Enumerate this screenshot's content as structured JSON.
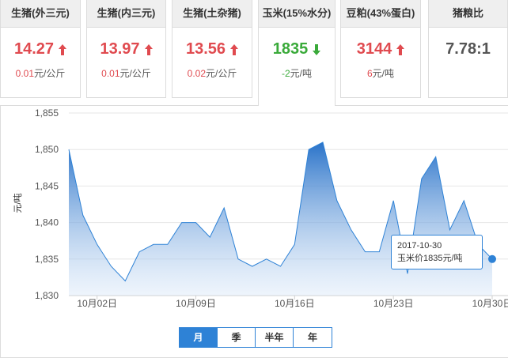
{
  "cards": [
    {
      "title": "生猪(外三元)",
      "price": "14.27",
      "trend": "up",
      "change": "0.01",
      "unit": "元/公斤"
    },
    {
      "title": "生猪(内三元)",
      "price": "13.97",
      "trend": "up",
      "change": "0.01",
      "unit": "元/公斤"
    },
    {
      "title": "生猪(土杂猪)",
      "price": "13.56",
      "trend": "up",
      "change": "0.02",
      "unit": "元/公斤"
    },
    {
      "title": "玉米(15%水分)",
      "price": "1835",
      "trend": "down",
      "change": "-2",
      "unit": "元/吨"
    },
    {
      "title": "豆粕(43%蛋白)",
      "price": "3144",
      "trend": "up",
      "change": "6",
      "unit": "元/吨"
    },
    {
      "title": "猪粮比",
      "price": "7.78:1",
      "trend": "neutral",
      "change": "",
      "unit": ""
    }
  ],
  "active_card": 3,
  "colors": {
    "up": "#e04a4f",
    "down": "#3aaa3a",
    "accent": "#2e82d6"
  },
  "tooltip": {
    "date": "2017-10-30",
    "text": "玉米价1835元/吨"
  },
  "range_tabs": [
    "月",
    "季",
    "半年",
    "年"
  ],
  "active_range": 0,
  "chart_data": {
    "type": "area",
    "ylabel": "元/吨",
    "ylim": [
      1830,
      1855
    ],
    "yticks": [
      "1,830",
      "1,835",
      "1,840",
      "1,845",
      "1,850",
      "1,855"
    ],
    "xticks": [
      "10月02日",
      "10月09日",
      "10月16日",
      "10月23日",
      "10月30日"
    ],
    "grid": true,
    "x": [
      "2017-09-30",
      "2017-10-01",
      "2017-10-02",
      "2017-10-03",
      "2017-10-04",
      "2017-10-05",
      "2017-10-06",
      "2017-10-07",
      "2017-10-08",
      "2017-10-09",
      "2017-10-10",
      "2017-10-11",
      "2017-10-12",
      "2017-10-13",
      "2017-10-14",
      "2017-10-15",
      "2017-10-16",
      "2017-10-17",
      "2017-10-18",
      "2017-10-19",
      "2017-10-20",
      "2017-10-21",
      "2017-10-22",
      "2017-10-23",
      "2017-10-24",
      "2017-10-25",
      "2017-10-26",
      "2017-10-27",
      "2017-10-28",
      "2017-10-29",
      "2017-10-30"
    ],
    "values": [
      1850,
      1841,
      1837,
      1834,
      1832,
      1836,
      1837,
      1837,
      1840,
      1840,
      1838,
      1842,
      1835,
      1834,
      1835,
      1834,
      1837,
      1850,
      1851,
      1843,
      1839,
      1836,
      1836,
      1843,
      1833,
      1846,
      1849,
      1839,
      1843,
      1837,
      1835
    ]
  }
}
